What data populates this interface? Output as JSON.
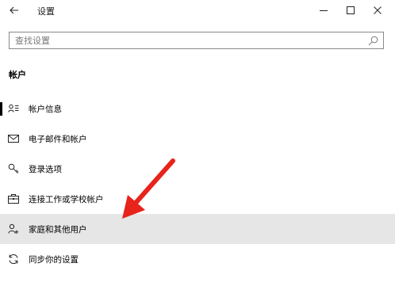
{
  "window": {
    "title": "设置"
  },
  "search": {
    "placeholder": "查找设置",
    "value": ""
  },
  "section": {
    "title": "帐户"
  },
  "nav": {
    "items": [
      {
        "label": "帐户信息",
        "icon": "account-info-icon",
        "selected": true
      },
      {
        "label": "电子邮件和帐户",
        "icon": "mail-icon"
      },
      {
        "label": "登录选项",
        "icon": "key-icon"
      },
      {
        "label": "连接工作或学校帐户",
        "icon": "briefcase-icon"
      },
      {
        "label": "家庭和其他用户",
        "icon": "add-person-icon",
        "highlighted": true
      },
      {
        "label": "同步你的设置",
        "icon": "sync-icon"
      }
    ]
  },
  "annotation": {
    "arrow_color": "#e8231b"
  },
  "colors": {
    "hover_background": "#e6e6e6",
    "text": "#000000"
  }
}
